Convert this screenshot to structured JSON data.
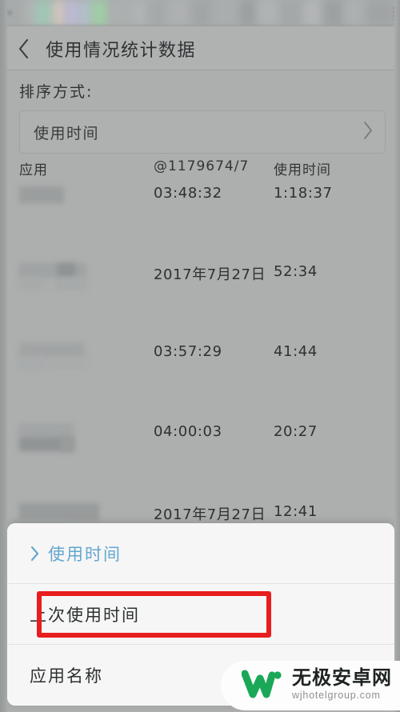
{
  "statusbar": {
    "blurred": true
  },
  "titlebar": {
    "back_icon": "chevron-left-icon",
    "title": "使用情况统计数据"
  },
  "sort": {
    "label": "排序方式:",
    "selected_value": "使用时间",
    "chevron_icon": "chevron-right-icon"
  },
  "table": {
    "headers": {
      "app": "应用",
      "last_used": "@1179674/7",
      "usage_time": "使用时间"
    },
    "rows": [
      {
        "app": "",
        "last_used": "03:48:32",
        "usage_time": "1:18:37"
      },
      {
        "app": "",
        "last_used": "2017年7月27日",
        "usage_time": "52:34"
      },
      {
        "app": "",
        "last_used": "03:57:29",
        "usage_time": "41:44"
      },
      {
        "app": "",
        "last_used": "04:00:03",
        "usage_time": "20:27"
      },
      {
        "app": "",
        "last_used": "2017年7月27日",
        "usage_time": "12:41"
      }
    ]
  },
  "bottom_sheet": {
    "options": [
      {
        "label": "使用时间",
        "selected": true,
        "chevron_icon": "chevron-right-icon"
      },
      {
        "label": "上次使用时间",
        "selected": false,
        "highlighted": true
      },
      {
        "label": "应用名称",
        "selected": false
      }
    ]
  },
  "annotation": {
    "highlight_color": "#e81d1d",
    "target_label": "上次使用时间"
  },
  "watermark": {
    "logo_icon": "w-logo-icon",
    "title": "无极安卓网",
    "domain": "wjhotelgroup.com",
    "logo_color": "#1aa858"
  },
  "colors": {
    "page_background": "#adaeae",
    "titlebar_background": "#b0b2b2",
    "sheet_background": "#f4f4f4",
    "accent_blue": "#63a6cf",
    "annotation_red": "#e81d1d"
  }
}
